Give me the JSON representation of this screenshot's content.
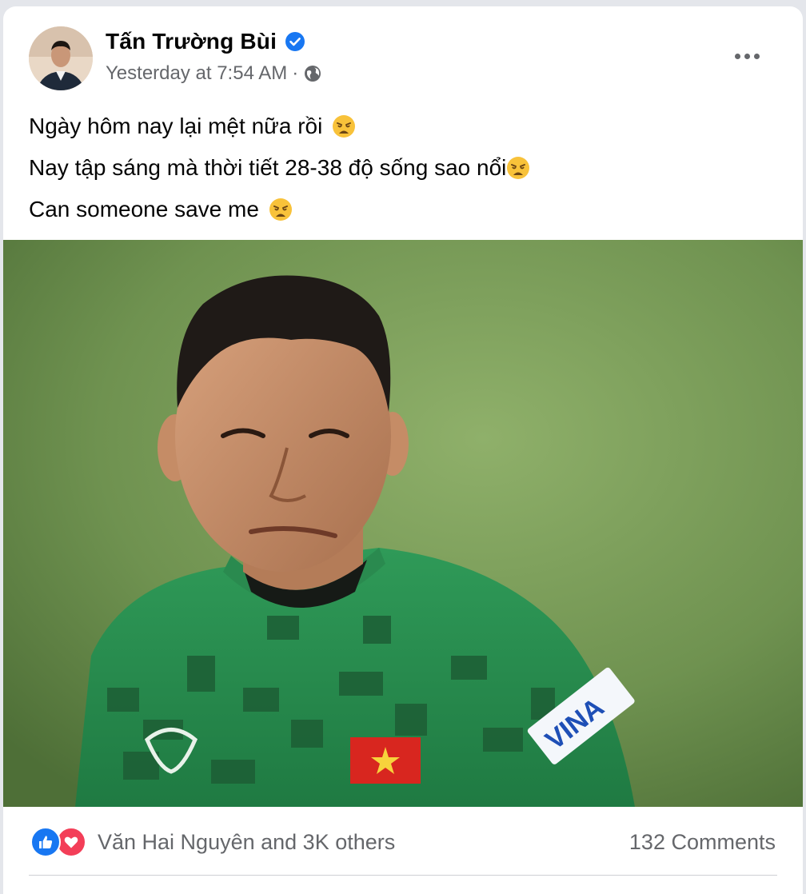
{
  "post": {
    "author": "Tấn Trường Bùi",
    "verified_icon": "verified-badge-icon",
    "timestamp": "Yesterday at 7:54 AM",
    "separator": "·",
    "audience_icon": "globe-icon",
    "more_icon": "more-options-icon",
    "lines": [
      "Ngày hôm nay lại mệt nữa rồi",
      "Nay tập sáng mà thời tiết 28-38 độ sống sao nổi",
      "Can someone save me"
    ],
    "emoji_icon": "weary-face-emoji",
    "photo_description": "",
    "jersey_sponsor": "VINA",
    "reactions_text": "Văn Hai Nguyên and 3K others",
    "comments_text": "132 Comments",
    "colors": {
      "brand_blue": "#1877f2",
      "love_red": "#f33e58",
      "secondary_text": "#65676b"
    }
  }
}
